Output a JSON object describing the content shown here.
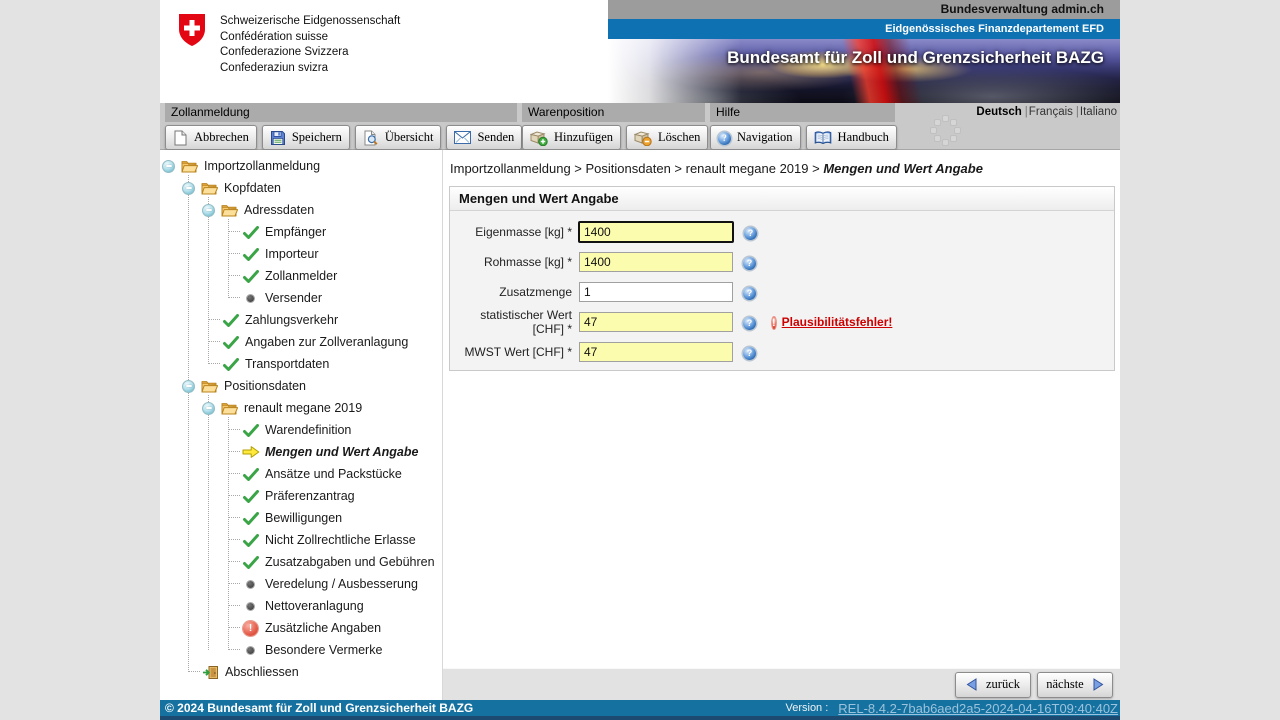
{
  "header": {
    "logo_lines": [
      "Schweizerische Eidgenossenschaft",
      "Confédération suisse",
      "Confederazione Svizzera",
      "Confederaziun svizra"
    ],
    "admin_bar": "Bundesverwaltung admin.ch",
    "dept_bar": "Eidgenössisches Finanzdepartement EFD",
    "office_title": "Bundesamt für Zoll und Grenzsicherheit BAZG"
  },
  "language": {
    "items": [
      "Deutsch",
      "Français",
      "Italiano"
    ],
    "selected": "Deutsch",
    "separator": "|"
  },
  "toolbar": {
    "groups": [
      {
        "label": "Zollanmeldung",
        "buttons": [
          {
            "icon": "document-icon",
            "label": "Abbrechen"
          },
          {
            "icon": "save-disk-icon",
            "label": "Speichern"
          },
          {
            "icon": "magnifier-page-icon",
            "label": "Übersicht"
          },
          {
            "icon": "envelope-icon",
            "label": "Senden"
          }
        ]
      },
      {
        "label": "Warenposition",
        "buttons": [
          {
            "icon": "box-add-icon",
            "label": "Hinzufügen"
          },
          {
            "icon": "box-remove-icon",
            "label": "Löschen"
          }
        ]
      },
      {
        "label": "Hilfe",
        "buttons": [
          {
            "icon": "help-ball-icon",
            "label": "Navigation"
          },
          {
            "icon": "book-icon",
            "label": "Handbuch"
          }
        ]
      }
    ]
  },
  "tree": {
    "items": [
      {
        "level": 0,
        "kind": "folder",
        "label": "Importzollanmeldung"
      },
      {
        "level": 1,
        "kind": "folder",
        "label": "Kopfdaten"
      },
      {
        "level": 2,
        "kind": "folder",
        "label": "Adressdaten"
      },
      {
        "level": 3,
        "kind": "leaf",
        "icon": "check",
        "label": "Empfänger"
      },
      {
        "level": 3,
        "kind": "leaf",
        "icon": "check",
        "label": "Importeur"
      },
      {
        "level": 3,
        "kind": "leaf",
        "icon": "check",
        "label": "Zollanmelder"
      },
      {
        "level": 3,
        "kind": "leaf",
        "icon": "bullet",
        "label": "Versender"
      },
      {
        "level": 2,
        "kind": "leaf",
        "icon": "check",
        "label": "Zahlungsverkehr"
      },
      {
        "level": 2,
        "kind": "leaf",
        "icon": "check",
        "label": "Angaben zur Zollveranlagung"
      },
      {
        "level": 2,
        "kind": "leaf",
        "icon": "check",
        "label": "Transportdaten"
      },
      {
        "level": 1,
        "kind": "folder",
        "label": "Positionsdaten"
      },
      {
        "level": 2,
        "kind": "folder",
        "label": "renault megane 2019"
      },
      {
        "level": 3,
        "kind": "leaf",
        "icon": "check",
        "label": "Warendefinition"
      },
      {
        "level": 3,
        "kind": "leaf",
        "icon": "arrow",
        "label": "Mengen und Wert Angabe",
        "current": true
      },
      {
        "level": 3,
        "kind": "leaf",
        "icon": "check",
        "label": "Ansätze und Packstücke"
      },
      {
        "level": 3,
        "kind": "leaf",
        "icon": "check",
        "label": "Präferenzantrag"
      },
      {
        "level": 3,
        "kind": "leaf",
        "icon": "check",
        "label": "Bewilligungen"
      },
      {
        "level": 3,
        "kind": "leaf",
        "icon": "check",
        "label": "Nicht Zollrechtliche Erlasse"
      },
      {
        "level": 3,
        "kind": "leaf",
        "icon": "check",
        "label": "Zusatzabgaben und Gebühren"
      },
      {
        "level": 3,
        "kind": "leaf",
        "icon": "bullet",
        "label": "Veredelung / Ausbesserung"
      },
      {
        "level": 3,
        "kind": "leaf",
        "icon": "bullet",
        "label": "Nettoveranlagung"
      },
      {
        "level": 3,
        "kind": "leaf",
        "icon": "error",
        "label": "Zusätzliche Angaben"
      },
      {
        "level": 3,
        "kind": "leaf",
        "icon": "bullet",
        "label": "Besondere Vermerke"
      },
      {
        "level": 1,
        "kind": "leaf",
        "icon": "exit",
        "label": "Abschliessen"
      }
    ]
  },
  "breadcrumb": {
    "segments": [
      "Importzollanmeldung",
      "Positionsdaten",
      "renault megane 2019",
      "Mengen und Wert Angabe"
    ],
    "separator": ">"
  },
  "panel": {
    "title": "Mengen und Wert Angabe",
    "fields": [
      {
        "label": "Eigenmasse [kg] *",
        "value": "1400",
        "required": true,
        "focused": true
      },
      {
        "label": "Rohmasse [kg] *",
        "value": "1400",
        "required": true
      },
      {
        "label": "Zusatzmenge",
        "value": "1",
        "required": false
      },
      {
        "label": "statistischer Wert [CHF] *",
        "value": "47",
        "required": true,
        "error": "Plausibilitätsfehler!"
      },
      {
        "label": "MWST Wert [CHF] *",
        "value": "47",
        "required": true
      }
    ]
  },
  "nav": {
    "back": "zurück",
    "next": "nächste"
  },
  "footer": {
    "copyright": "© 2024 Bundesamt für Zoll und Grenzsicherheit BAZG",
    "version_label": "Version :",
    "version_link": "REL-8.4.2-7bab6aed2a5-2024-04-16T09:40:40Z"
  },
  "colors": {
    "dept_blue": "#0e72b2",
    "footer_teal": "#15719f",
    "required_yellow": "#fcfcaf",
    "error_red": "#cc0000",
    "swiss_red": "#e30613"
  }
}
